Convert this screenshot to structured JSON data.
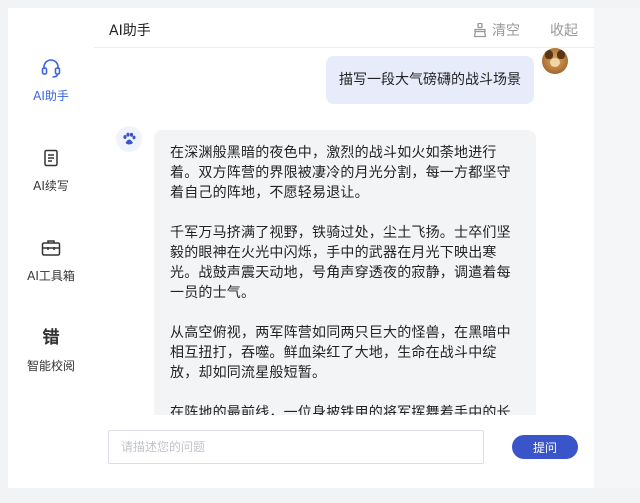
{
  "sidebar": {
    "items": [
      {
        "label": "AI助手",
        "icon": "headset-icon",
        "active": true
      },
      {
        "label": "AI续写",
        "icon": "document-icon",
        "active": false
      },
      {
        "label": "AI工具箱",
        "icon": "toolbox-icon",
        "active": false
      },
      {
        "label": "智能校阅",
        "icon": "proofread-icon",
        "glyph": "错",
        "active": false
      }
    ]
  },
  "header": {
    "title": "AI助手",
    "clear_label": "清空",
    "collapse_label": "收起"
  },
  "chat": {
    "user_message": "描写一段大气磅礴的战斗场景",
    "bot_paragraphs": [
      "在深渊般黑暗的夜色中，激烈的战斗如火如荼地进行着。双方阵营的界限被凄冷的月光分割，每一方都坚守着自己的阵地，不愿轻易退让。",
      "千军万马挤满了视野，铁骑过处，尘土飞扬。士卒们坚毅的眼神在火光中闪烁，手中的武器在月光下映出寒光。战鼓声震天动地，号角声穿透夜的寂静，调遣着每一员的士气。",
      "从高空俯视，两军阵营如同两只巨大的怪兽，在黑暗中相互扭打，吞噬。鲜血染红了大地，生命在战斗中绽放，却如同流星般短暂。",
      "在阵地的最前线，一位身披铁甲的将军挥舞着手中的长剑，他的每一次呼喊都引动着士兵们的热血。他像一头雄狮，率领着他的军队冲锋陷阵。"
    ]
  },
  "input": {
    "placeholder": "请描述您的问题",
    "value": "",
    "submit_label": "提问"
  },
  "colors": {
    "accent": "#3a55c9",
    "active_label": "#3a63e0",
    "user_bubble": "#e7ebfa",
    "bot_bubble": "#f3f4f6"
  }
}
